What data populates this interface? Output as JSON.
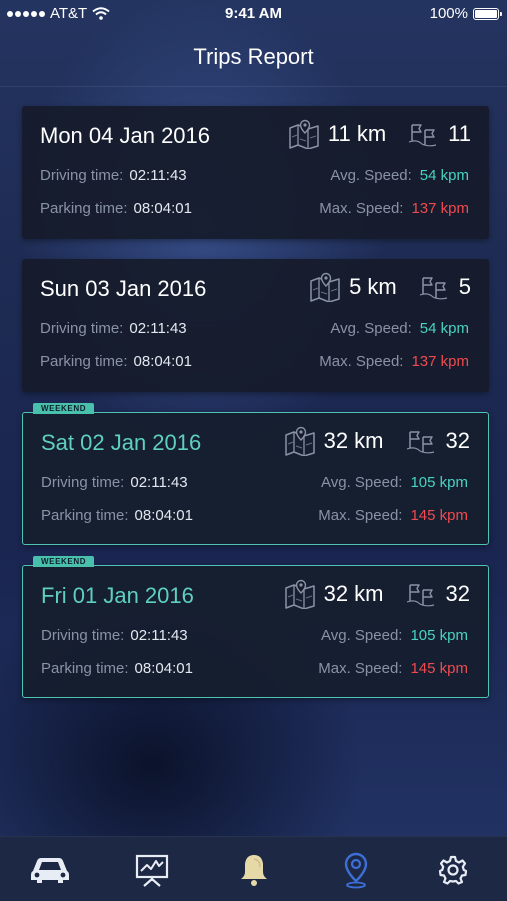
{
  "status_bar": {
    "carrier": "AT&T",
    "time": "9:41 AM",
    "battery": "100%"
  },
  "header": {
    "title": "Trips Report"
  },
  "labels": {
    "driving_time": "Driving time:",
    "parking_time": "Parking time:",
    "avg_speed": "Avg. Speed:",
    "max_speed": "Max. Speed:",
    "weekend_tag": "WEEKEND"
  },
  "trips": [
    {
      "date": "Mon 04 Jan 2016",
      "distance": "11 km",
      "trip_count": "11",
      "driving_time": "02:11:43",
      "parking_time": "08:04:01",
      "avg_speed": "54 kpm",
      "max_speed": "137 kpm",
      "weekend": false
    },
    {
      "date": "Sun 03 Jan 2016",
      "distance": "5 km",
      "trip_count": "5",
      "driving_time": "02:11:43",
      "parking_time": "08:04:01",
      "avg_speed": "54 kpm",
      "max_speed": "137 kpm",
      "weekend": false
    },
    {
      "date": "Sat 02 Jan 2016",
      "distance": "32 km",
      "trip_count": "32",
      "driving_time": "02:11:43",
      "parking_time": "08:04:01",
      "avg_speed": "105 kpm",
      "max_speed": "145 kpm",
      "weekend": true
    },
    {
      "date": "Fri 01 Jan 2016",
      "distance": "32 km",
      "trip_count": "32",
      "driving_time": "02:11:43",
      "parking_time": "08:04:01",
      "avg_speed": "105 kpm",
      "max_speed": "145 kpm",
      "weekend": true
    }
  ],
  "tab_bar": {
    "tabs": [
      {
        "icon": "car-icon",
        "active": false
      },
      {
        "icon": "chart-board-icon",
        "active": false
      },
      {
        "icon": "bell-icon",
        "active": false
      },
      {
        "icon": "location-pin-icon",
        "active": true
      },
      {
        "icon": "gear-icon",
        "active": false
      }
    ]
  },
  "colors": {
    "accent_teal": "#48d3c2",
    "max_speed_red": "#ee4a4f",
    "active_tab_blue": "#3d6fd6"
  }
}
